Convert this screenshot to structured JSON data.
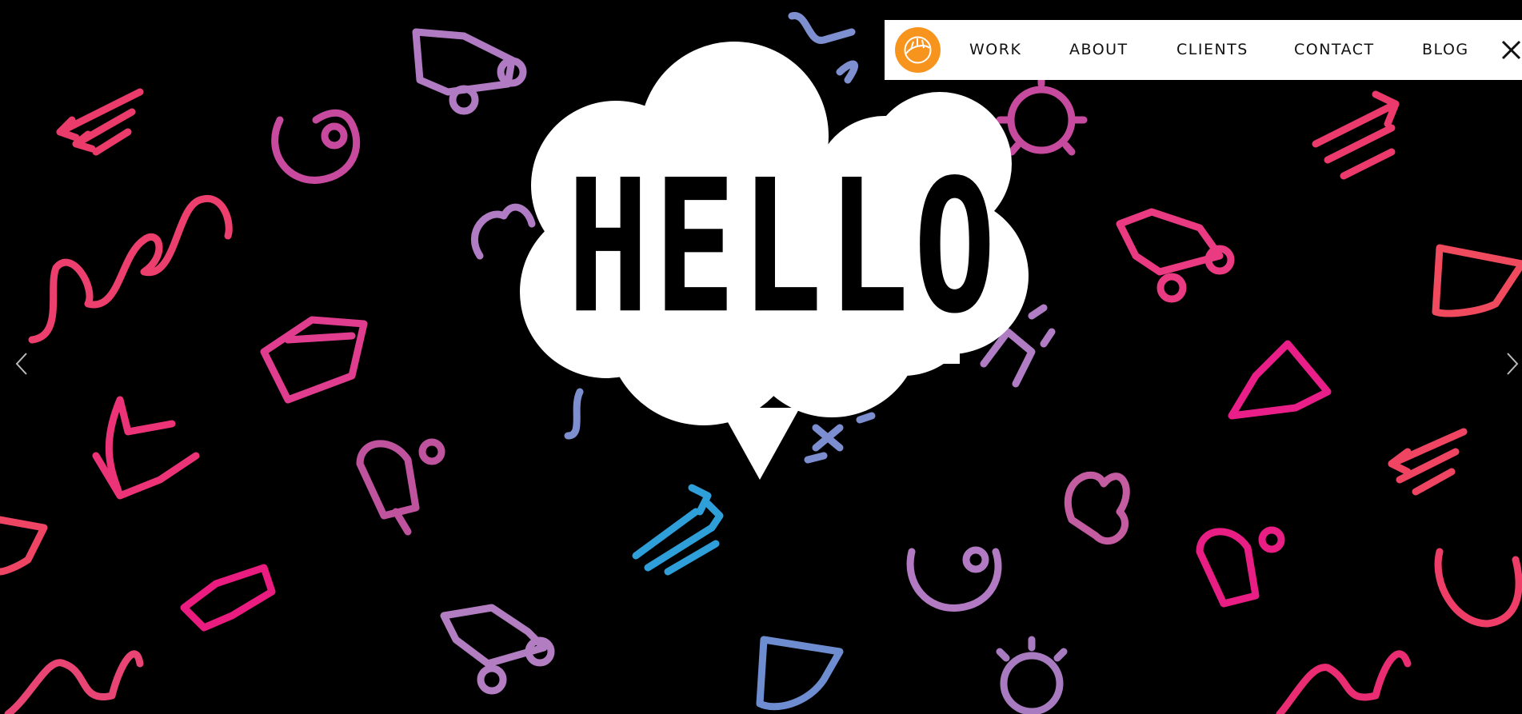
{
  "hero": {
    "headline": "HELLO"
  },
  "nav": {
    "items": [
      {
        "id": "work",
        "label": "WORK"
      },
      {
        "id": "about",
        "label": "ABOUT"
      },
      {
        "id": "clients",
        "label": "CLIENTS"
      },
      {
        "id": "contact",
        "label": "CONTACT"
      },
      {
        "id": "blog",
        "label": "BLOG"
      }
    ]
  },
  "icons": {
    "logo": "orange-sun-logo-icon",
    "close": "close-icon",
    "prev": "chevron-left-icon",
    "next": "chevron-right-icon"
  },
  "colors": {
    "background": "#000000",
    "logo": "#f7941d",
    "pink": "#ec2f6e",
    "magenta": "#e0208c",
    "purple": "#a97bc0",
    "blue": "#2d9fd8",
    "periwinkle": "#7d8fd0"
  }
}
